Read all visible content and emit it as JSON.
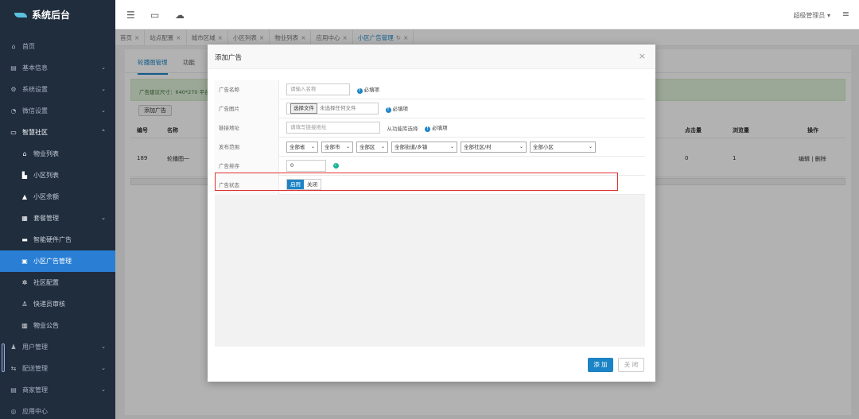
{
  "app": {
    "title": "系统后台"
  },
  "sidebar": {
    "items": [
      {
        "label": "首页",
        "icon": "home-icon",
        "glyph": "⌂",
        "arrow": ""
      },
      {
        "label": "基本信息",
        "icon": "list-icon",
        "glyph": "▤",
        "arrow": "⌄"
      },
      {
        "label": "系统设置",
        "icon": "gear-icon",
        "glyph": "⚙",
        "arrow": "⌄"
      },
      {
        "label": "微信设置",
        "icon": "wechat-icon",
        "glyph": "◔",
        "arrow": "⌄"
      },
      {
        "label": "智慧社区",
        "icon": "community-icon",
        "glyph": "▭",
        "arrow": "⌃"
      }
    ],
    "subitems": [
      {
        "label": "物业列表",
        "icon": "home-icon",
        "glyph": "⌂"
      },
      {
        "label": "小区列表",
        "icon": "building-icon",
        "glyph": "▙"
      },
      {
        "label": "小区余额",
        "icon": "balance-icon",
        "glyph": "▲"
      },
      {
        "label": "套餐管理",
        "icon": "package-icon",
        "glyph": "▦"
      },
      {
        "label": "智能硬件广告",
        "icon": "hardware-icon",
        "glyph": "▬"
      },
      {
        "label": "小区广告管理",
        "icon": "ad-icon",
        "glyph": "▣"
      },
      {
        "label": "社区配置",
        "icon": "config-icon",
        "glyph": "✲"
      },
      {
        "label": "快递员审核",
        "icon": "courier-icon",
        "glyph": "♙"
      },
      {
        "label": "物业公告",
        "icon": "notice-icon",
        "glyph": "▥"
      }
    ],
    "bottom": [
      {
        "label": "用户管理",
        "icon": "user-icon",
        "glyph": "♟"
      },
      {
        "label": "配送管理",
        "icon": "delivery-icon",
        "glyph": "⇆"
      },
      {
        "label": "商家管理",
        "icon": "shop-icon",
        "glyph": "▤"
      },
      {
        "label": "应用中心",
        "icon": "app-icon",
        "glyph": "◎"
      }
    ]
  },
  "topbar": {
    "user": "超级管理员 ▾"
  },
  "tabs": [
    {
      "label": "首页"
    },
    {
      "label": "站点配置"
    },
    {
      "label": "城市区域"
    },
    {
      "label": "小区列表"
    },
    {
      "label": "物业列表"
    },
    {
      "label": "应用中心"
    },
    {
      "label": "小区广告管理"
    }
  ],
  "content": {
    "tab1": "轮播图管理",
    "tab2": "功能",
    "alert": "广告建议尺寸：640*270 平台",
    "add_button": "添加广告",
    "headers": {
      "id": "编号",
      "name": "名称",
      "clicks": "点击量",
      "views": "浏览量",
      "ops": "操作"
    },
    "row": {
      "id": "189",
      "name": "轮播图一",
      "clicks": "0",
      "views": "1",
      "ops": "编辑 | 删除"
    }
  },
  "modal": {
    "title": "添加广告",
    "required": "必填项",
    "fields": {
      "name": {
        "label": "广告名称",
        "placeholder": "请输入名称"
      },
      "image": {
        "label": "广告图片",
        "file_button": "选择文件",
        "file_text": "未选择任何文件"
      },
      "link": {
        "label": "链接地址",
        "placeholder": "请填写链接地址",
        "extra": "从功能库选择"
      },
      "scope": {
        "label": "发布范围",
        "province": "全部省",
        "city": "全部市",
        "district": "全部区",
        "street": "全部街道/乡镇",
        "community": "全部社区/村",
        "estate": "全部小区"
      },
      "sort": {
        "label": "广告排序",
        "value": "0"
      },
      "status": {
        "label": "广告状态",
        "on": "启用",
        "off": "关闭"
      }
    },
    "add_button": "添 加",
    "close_button": "关 闭"
  }
}
